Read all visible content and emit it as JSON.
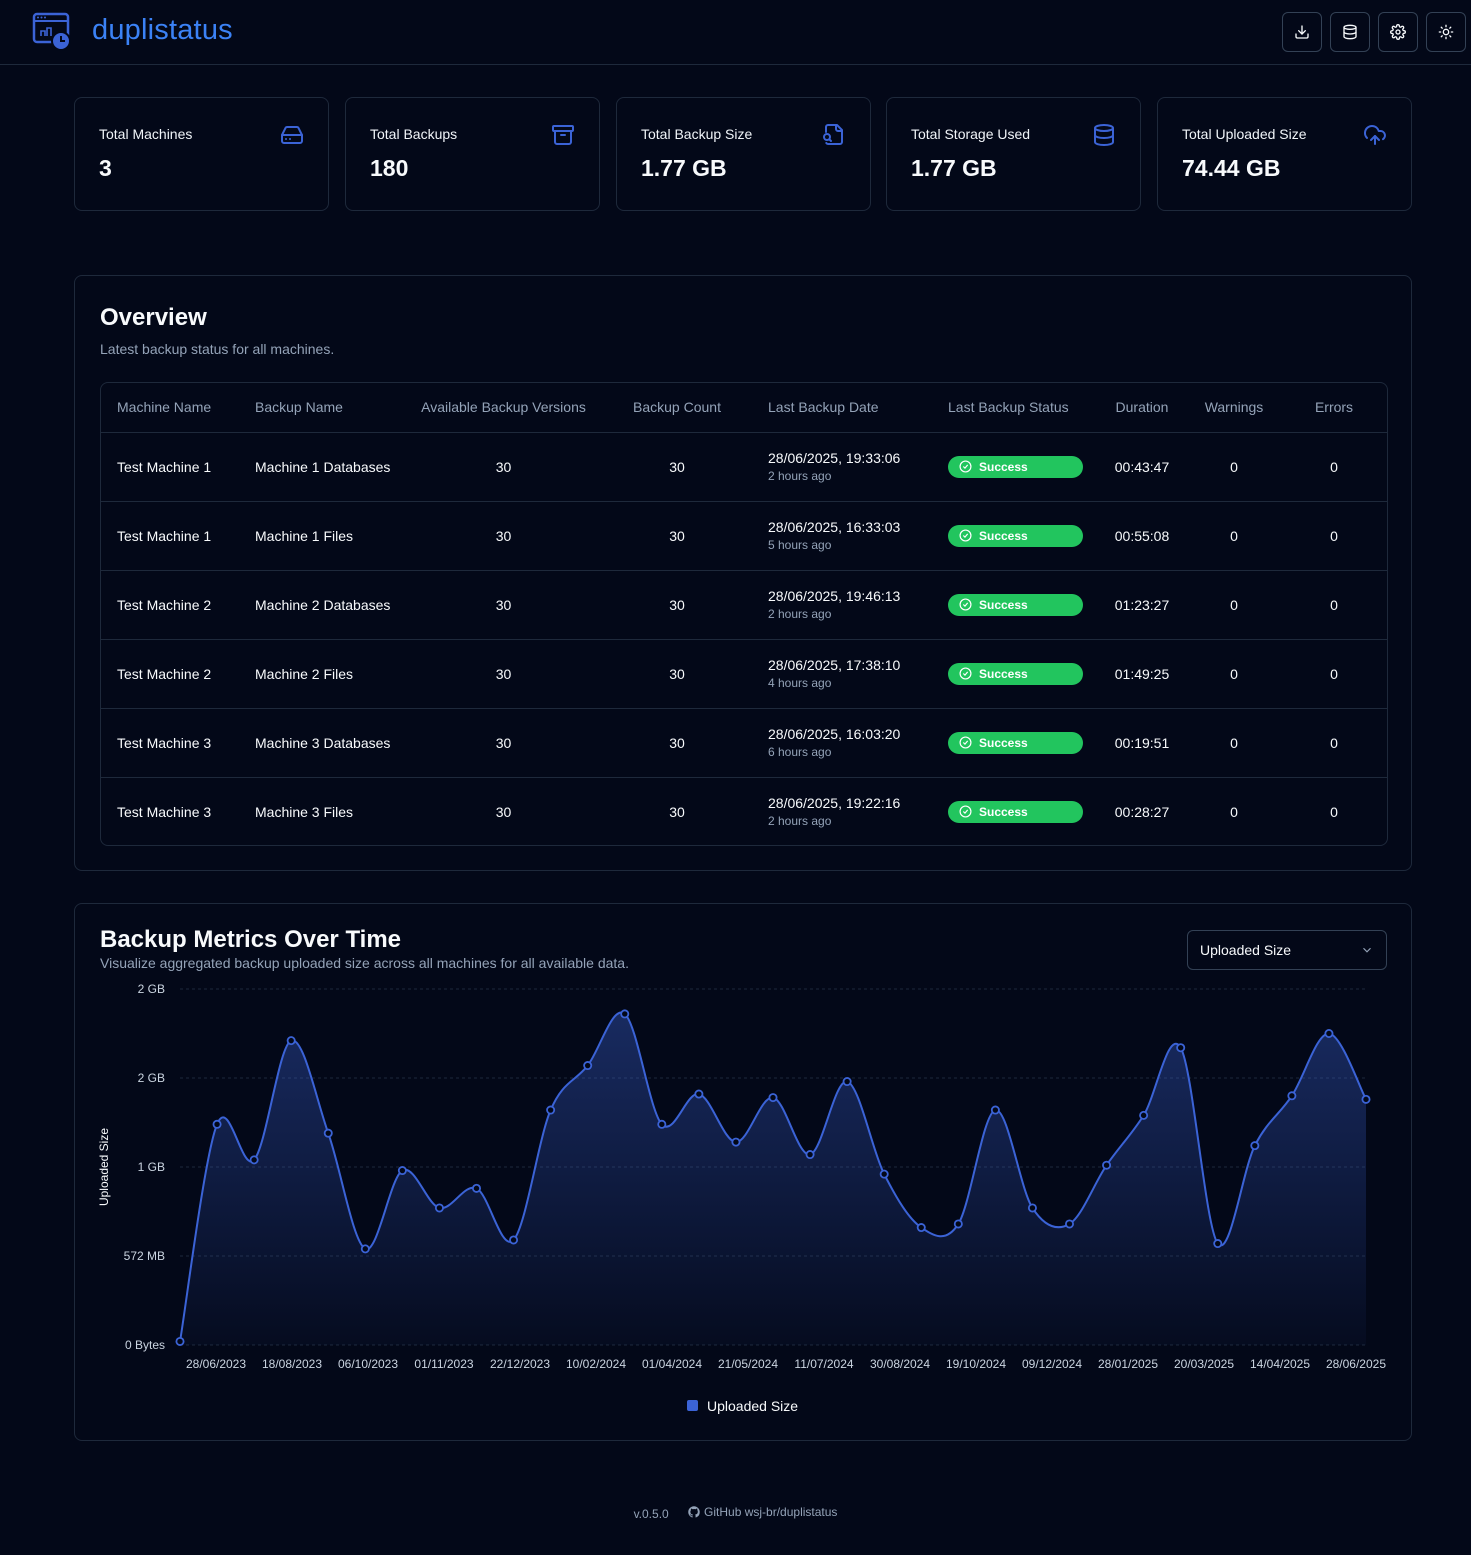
{
  "header": {
    "title": "duplistatus",
    "buttons": [
      "download-icon",
      "database-icon",
      "gear-icon",
      "sun-icon"
    ]
  },
  "stats": [
    {
      "label": "Total Machines",
      "value": "3",
      "icon": "hard-drive-icon"
    },
    {
      "label": "Total Backups",
      "value": "180",
      "icon": "archive-icon"
    },
    {
      "label": "Total Backup Size",
      "value": "1.77 GB",
      "icon": "file-search-icon"
    },
    {
      "label": "Total Storage Used",
      "value": "1.77 GB",
      "icon": "database-icon"
    },
    {
      "label": "Total Uploaded Size",
      "value": "74.44 GB",
      "icon": "cloud-upload-icon"
    }
  ],
  "overview": {
    "title": "Overview",
    "subtitle": "Latest backup status for all machines.",
    "columns": [
      "Machine Name",
      "Backup Name",
      "Available Backup Versions",
      "Backup Count",
      "Last Backup Date",
      "Last Backup Status",
      "Duration",
      "Warnings",
      "Errors"
    ],
    "rows": [
      {
        "machine": "Test Machine 1",
        "backup": "Machine 1 Databases",
        "versions": "30",
        "count": "30",
        "date": "28/06/2025, 19:33:06",
        "ago": "2 hours ago",
        "status": "Success",
        "duration": "00:43:47",
        "warnings": "0",
        "errors": "0"
      },
      {
        "machine": "Test Machine 1",
        "backup": "Machine 1 Files",
        "versions": "30",
        "count": "30",
        "date": "28/06/2025, 16:33:03",
        "ago": "5 hours ago",
        "status": "Success",
        "duration": "00:55:08",
        "warnings": "0",
        "errors": "0"
      },
      {
        "machine": "Test Machine 2",
        "backup": "Machine 2 Databases",
        "versions": "30",
        "count": "30",
        "date": "28/06/2025, 19:46:13",
        "ago": "2 hours ago",
        "status": "Success",
        "duration": "01:23:27",
        "warnings": "0",
        "errors": "0"
      },
      {
        "machine": "Test Machine 2",
        "backup": "Machine 2 Files",
        "versions": "30",
        "count": "30",
        "date": "28/06/2025, 17:38:10",
        "ago": "4 hours ago",
        "status": "Success",
        "duration": "01:49:25",
        "warnings": "0",
        "errors": "0"
      },
      {
        "machine": "Test Machine 3",
        "backup": "Machine 3 Databases",
        "versions": "30",
        "count": "30",
        "date": "28/06/2025, 16:03:20",
        "ago": "6 hours ago",
        "status": "Success",
        "duration": "00:19:51",
        "warnings": "0",
        "errors": "0"
      },
      {
        "machine": "Test Machine 3",
        "backup": "Machine 3 Files",
        "versions": "30",
        "count": "30",
        "date": "28/06/2025, 19:22:16",
        "ago": "2 hours ago",
        "status": "Success",
        "duration": "00:28:27",
        "warnings": "0",
        "errors": "0"
      }
    ]
  },
  "metrics": {
    "title": "Backup Metrics Over Time",
    "subtitle": "Visualize aggregated backup uploaded size across all machines for all available data.",
    "select_value": "Uploaded Size"
  },
  "chart_data": {
    "type": "area",
    "ylabel": "Uploaded Size",
    "ylim": [
      0,
      2
    ],
    "y_unit": "GB",
    "y_tick_labels": [
      "0 Bytes",
      "572 MB",
      "1 GB",
      "2 GB",
      "2 GB"
    ],
    "x_tick_labels": [
      "28/06/2023",
      "18/08/2023",
      "06/10/2023",
      "01/11/2023",
      "22/12/2023",
      "10/02/2024",
      "01/04/2024",
      "21/05/2024",
      "11/07/2024",
      "30/08/2024",
      "19/10/2024",
      "09/12/2024",
      "28/01/2025",
      "20/03/2025",
      "14/04/2025",
      "28/06/2025"
    ],
    "legend": [
      "Uploaded Size"
    ],
    "legend_position": "bottom",
    "grid": true,
    "color": "#3b63d6",
    "series": [
      {
        "name": "Uploaded Size",
        "values": [
          0.02,
          1.24,
          1.04,
          1.71,
          1.19,
          0.54,
          0.98,
          0.77,
          0.88,
          0.59,
          1.32,
          1.57,
          1.86,
          1.24,
          1.41,
          1.14,
          1.39,
          1.07,
          1.48,
          0.96,
          0.66,
          0.68,
          1.32,
          0.77,
          0.68,
          1.01,
          1.29,
          1.67,
          0.57,
          1.12,
          1.4,
          1.75,
          1.38
        ]
      }
    ]
  },
  "footer": {
    "version": "v.0.5.0",
    "github": "GitHub wsj-br/duplistatus"
  }
}
